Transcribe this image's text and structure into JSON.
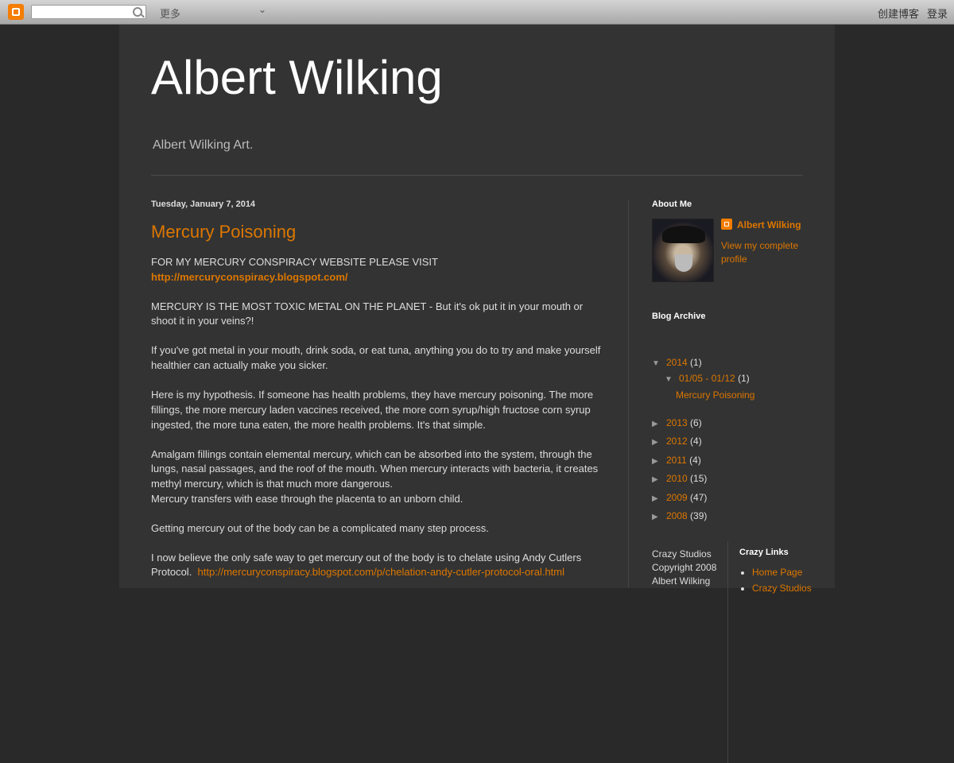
{
  "navbar": {
    "search_placeholder": "",
    "more_label": "更多",
    "create_blog_label": "创建博客",
    "login_label": "登录"
  },
  "header": {
    "title": "Albert Wilking",
    "description": "Albert Wilking Art."
  },
  "post": {
    "date": "Tuesday, January 7, 2014",
    "title": "Mercury Poisoning",
    "para1_text": "FOR MY MERCURY CONSPIRACY WEBSITE PLEASE VISIT",
    "para1_link": "http://mercuryconspiracy.blogspot.com/",
    "para2": "MERCURY IS THE MOST TOXIC METAL ON THE PLANET - But it's ok put it in your mouth or shoot it in your veins?!",
    "para3": "If you've got metal in your mouth, drink soda, or eat tuna, anything you do to try and make yourself healthier can actually make you sicker.",
    "para4": "Here is my hypothesis.  If someone has health problems, they have mercury poisoning.  The more fillings, the more mercury laden vaccines received, the more corn syrup/high fructose corn syrup ingested, the more tuna eaten, the more health problems.  It's that simple.",
    "para5a": "Amalgam fillings contain elemental mercury, which can be absorbed into the system, through the lungs, nasal passages, and the roof of the mouth.  When mercury interacts with bacteria, it creates methyl mercury, which is that much more dangerous.",
    "para5b": "Mercury transfers with ease through the placenta to an unborn child.",
    "para6": "Getting mercury out of the body can be a complicated many step process.",
    "para7_text": "I now believe the only safe way to get mercury out of the body is to chelate using Andy Cutlers Protocol.",
    "para7_link": "http://mercuryconspiracy.blogspot.com/p/chelation-andy-cutler-protocol-oral.html"
  },
  "sidebar": {
    "about_heading": "About Me",
    "profile_name": "Albert Wilking",
    "profile_link": "View my complete profile",
    "archive_heading": "Blog Archive",
    "archive": {
      "y2014": {
        "year": "2014",
        "count": "(1)"
      },
      "week": {
        "range": "01/05 - 01/12",
        "count": "(1)"
      },
      "post_link": "Mercury Poisoning",
      "y2013": {
        "year": "2013",
        "count": "(6)"
      },
      "y2012": {
        "year": "2012",
        "count": "(4)"
      },
      "y2011": {
        "year": "2011",
        "count": "(4)"
      },
      "y2010": {
        "year": "2010",
        "count": "(15)"
      },
      "y2009": {
        "year": "2009",
        "count": "(47)"
      },
      "y2008": {
        "year": "2008",
        "count": "(39)"
      }
    },
    "copyright": "Crazy Studios Copyright 2008 Albert Wilking",
    "links_heading": "Crazy Links",
    "links": [
      "Home Page",
      "Crazy Studios"
    ]
  },
  "colors": {
    "link": "#dd7700",
    "background": "#292929",
    "content_bg": "#333333",
    "blogger_orange": "#f57d00"
  },
  "icons": [
    "blogger-logo-icon",
    "search-icon",
    "chevron-down-icon",
    "blogger-profile-icon",
    "triangle-down-icon",
    "triangle-right-icon"
  ]
}
